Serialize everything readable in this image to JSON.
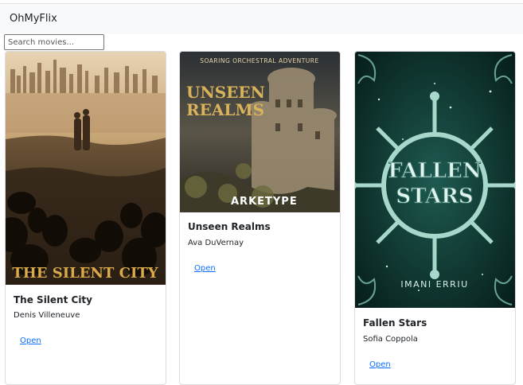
{
  "app": {
    "brand": "OhMyFlix"
  },
  "search": {
    "placeholder": "Search movies..."
  },
  "movies": [
    {
      "title": "The Silent City",
      "director": "Denis Villeneuve",
      "link_label": "Open",
      "poster": {
        "title_text": "THE SILENT CITY"
      }
    },
    {
      "title": "Unseen Realms",
      "director": "Ava DuVernay",
      "link_label": "Open",
      "poster": {
        "tagline": "SOARING ORCHESTRAL ADVENTURE",
        "title_line1": "UNSEEN",
        "title_line2": "REALMS",
        "credit": "ARKETYPE"
      }
    },
    {
      "title": "Fallen Stars",
      "director": "Sofia Coppola",
      "link_label": "Open",
      "poster": {
        "title_line1": "FALLEN",
        "title_line2": "STARS",
        "credit": "IMANI ERRIU"
      }
    }
  ]
}
